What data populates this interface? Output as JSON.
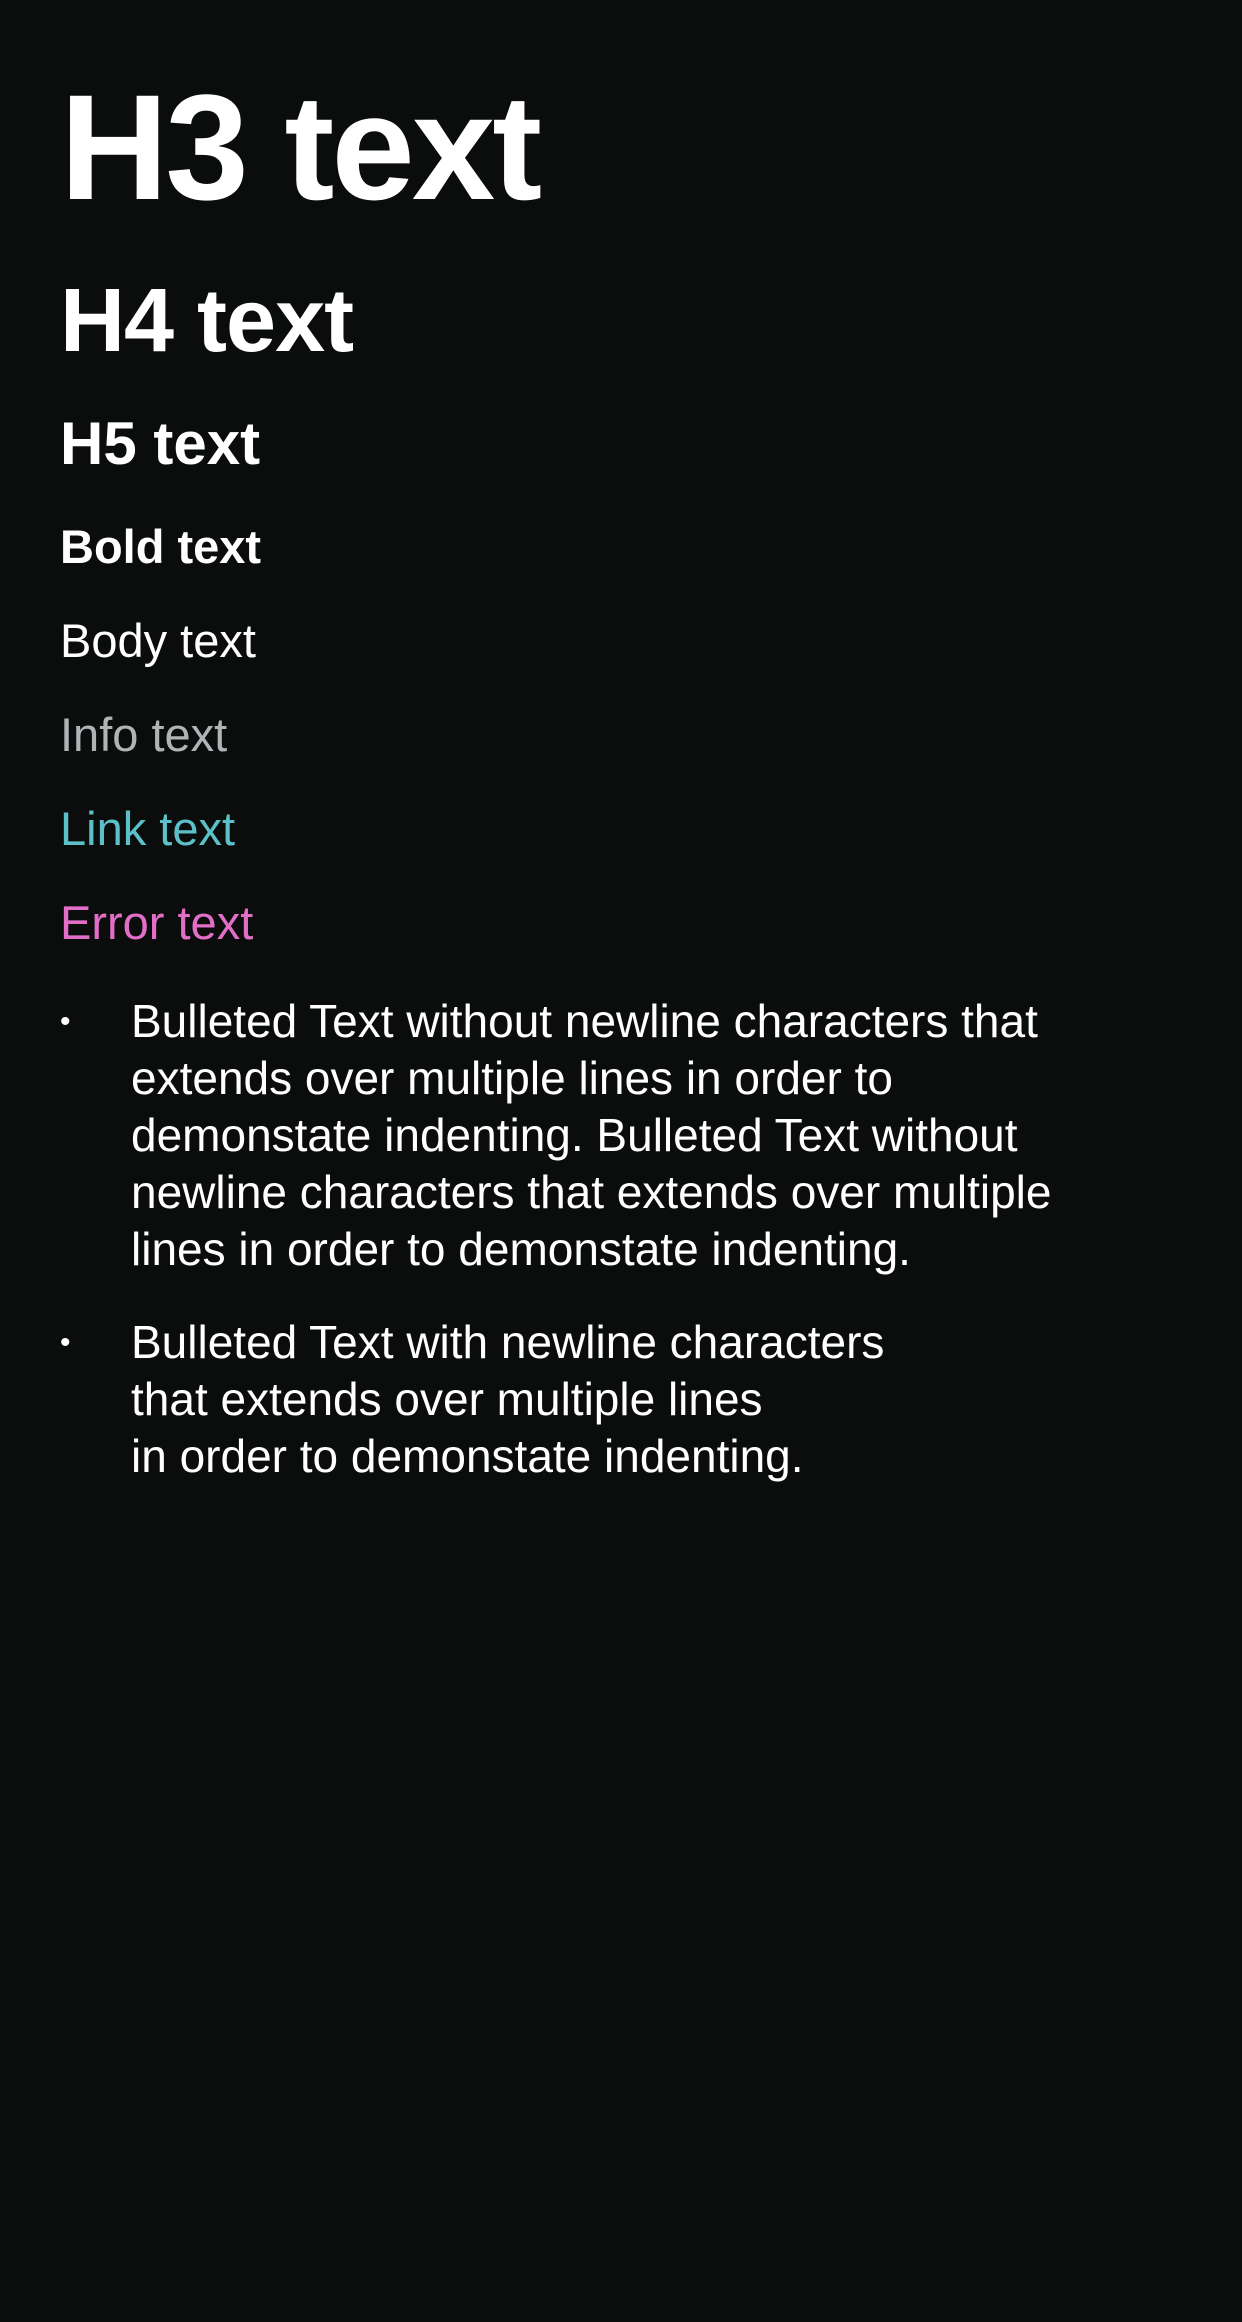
{
  "colors": {
    "background": "#0b0c0c",
    "primary_text": "#ffffff",
    "info_text": "#b1b4b6",
    "link_text": "#5bc0c8",
    "error_text": "#e36ec7"
  },
  "typography": {
    "h3": "H3 text",
    "h4": "H4 text",
    "h5": "H5 text",
    "bold": "Bold text",
    "body": "Body text",
    "info": "Info text",
    "link": "Link text",
    "error": "Error text"
  },
  "bullets": {
    "marker": "•",
    "wrapped_item": {
      "lines": [
        "Bulleted Text without newline characters that",
        "extends over multiple lines in order to",
        "demonstate indenting. Bulleted Text without",
        "newline characters that extends over multiple",
        "lines in order to demonstate indenting."
      ]
    },
    "newline_item": {
      "lines": [
        "Bulleted Text with newline characters",
        "that extends over multiple lines",
        "in order to demonstate indenting."
      ]
    }
  }
}
